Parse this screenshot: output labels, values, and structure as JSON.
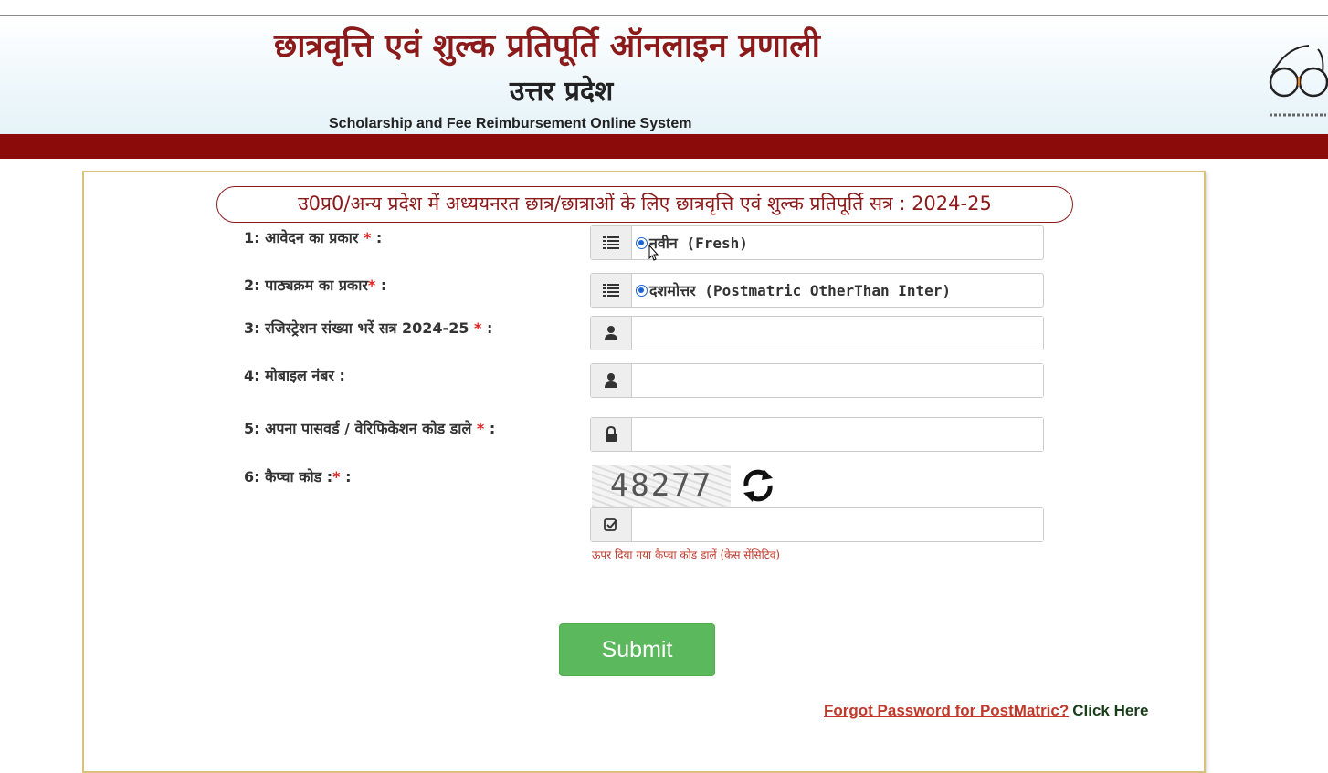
{
  "header": {
    "title_hi": "छात्रवृत्ति एवं शुल्क प्रतिपूर्ति ऑनलाइन प्रणाली",
    "subtitle_hi": "उत्तर प्रदेश",
    "title_en": "Scholarship and Fee Reimbursement Online System",
    "logo_icon": "swachh-bharat-glasses-icon",
    "band_color": "#8b0a0a",
    "title_color": "#8b1a1a"
  },
  "form": {
    "session_title": "उ0प्र0/अन्य प्रदेश में अध्ययनरत छात्र/छात्राओं के लिए छात्रवृत्ति एवं शुल्क प्रतिपूर्ति सत्र : 2024-25",
    "fields": [
      {
        "label": "1: आवेदन का प्रकार",
        "required_mark": " * ",
        "suffix": ":",
        "icon": "list-icon",
        "value": "नवीन (Fresh)"
      },
      {
        "label": "2: पाठ्यक्रम का प्रकार",
        "required_mark": "* ",
        "suffix": ":",
        "icon": "list-icon",
        "value": "दशमोत्तर (Postmatric OtherThan Inter)"
      },
      {
        "label": "3: रजिस्ट्रेशन संख्या भरें सत्र 2024-25",
        "required_mark": " * ",
        "suffix": ":",
        "icon": "user-icon",
        "value": ""
      },
      {
        "label": "4: मोबाइल नंबर :",
        "icon": "user-icon",
        "value": ""
      },
      {
        "label": "5: अपना पासवर्ड / वेरिफिकेशन कोड डाले",
        "required_mark": " * ",
        "suffix": ":",
        "icon": "lock-icon",
        "value": ""
      },
      {
        "label": "6: कैप्चा कोड :",
        "required_mark": "* ",
        "suffix": ":",
        "icon": "check-square-icon",
        "value": ""
      }
    ],
    "captcha_text": "48277",
    "captcha_hint": "ऊपर दिया गया कैप्चा कोड डालें (केस सेंसिटिव)",
    "submit_label": "Submit",
    "forgot_link": "Forgot Password for PostMatric?",
    "click_here": "Click Here",
    "accent_green": "#5cb85c",
    "radio_color": "#1a64d6"
  }
}
